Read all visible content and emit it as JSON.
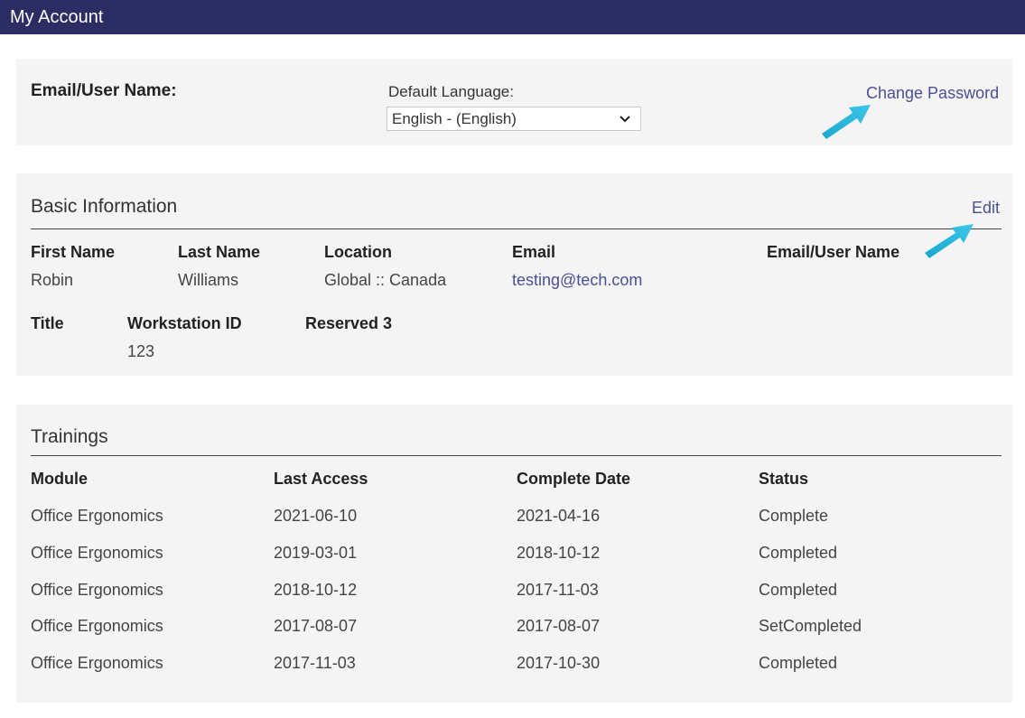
{
  "header": {
    "title": "My Account"
  },
  "account": {
    "email_label": "Email/User Name:",
    "language_label": "Default Language:",
    "language_value": "English - (English)",
    "change_password": "Change Password"
  },
  "basic": {
    "title": "Basic Information",
    "edit": "Edit",
    "fields_row1": [
      {
        "label": "First Name",
        "value": "Robin"
      },
      {
        "label": "Last Name",
        "value": "Williams"
      },
      {
        "label": "Location",
        "value": "Global :: Canada"
      },
      {
        "label": "Email",
        "value": "testing@tech.com"
      },
      {
        "label": "Email/User Name",
        "value": ""
      }
    ],
    "fields_row2": [
      {
        "label": "Title",
        "value": ""
      },
      {
        "label": "Workstation ID",
        "value": "123"
      },
      {
        "label": "Reserved 3",
        "value": ""
      }
    ]
  },
  "trainings": {
    "title": "Trainings",
    "columns": [
      "Module",
      "Last Access",
      "Complete Date",
      "Status"
    ],
    "rows": [
      [
        "Office Ergonomics",
        "2021-06-10",
        "2021-04-16",
        "Complete"
      ],
      [
        "Office Ergonomics",
        "2019-03-01",
        "2018-10-12",
        "Completed"
      ],
      [
        "Office Ergonomics",
        "2018-10-12",
        "2017-11-03",
        "Completed"
      ],
      [
        "Office Ergonomics",
        "2017-08-07",
        "2017-08-07",
        "SetCompleted"
      ],
      [
        "Office Ergonomics",
        "2017-11-03",
        "2017-10-30",
        "Completed"
      ]
    ]
  },
  "icons": {
    "annotation_arrow": "arrow-icon",
    "select_chevron": "chevron-down-icon"
  },
  "colors": {
    "header": "#2b2d63",
    "panel": "#f4f4f4",
    "link": "#4a4f95",
    "arrow": "#1ab0d8"
  }
}
